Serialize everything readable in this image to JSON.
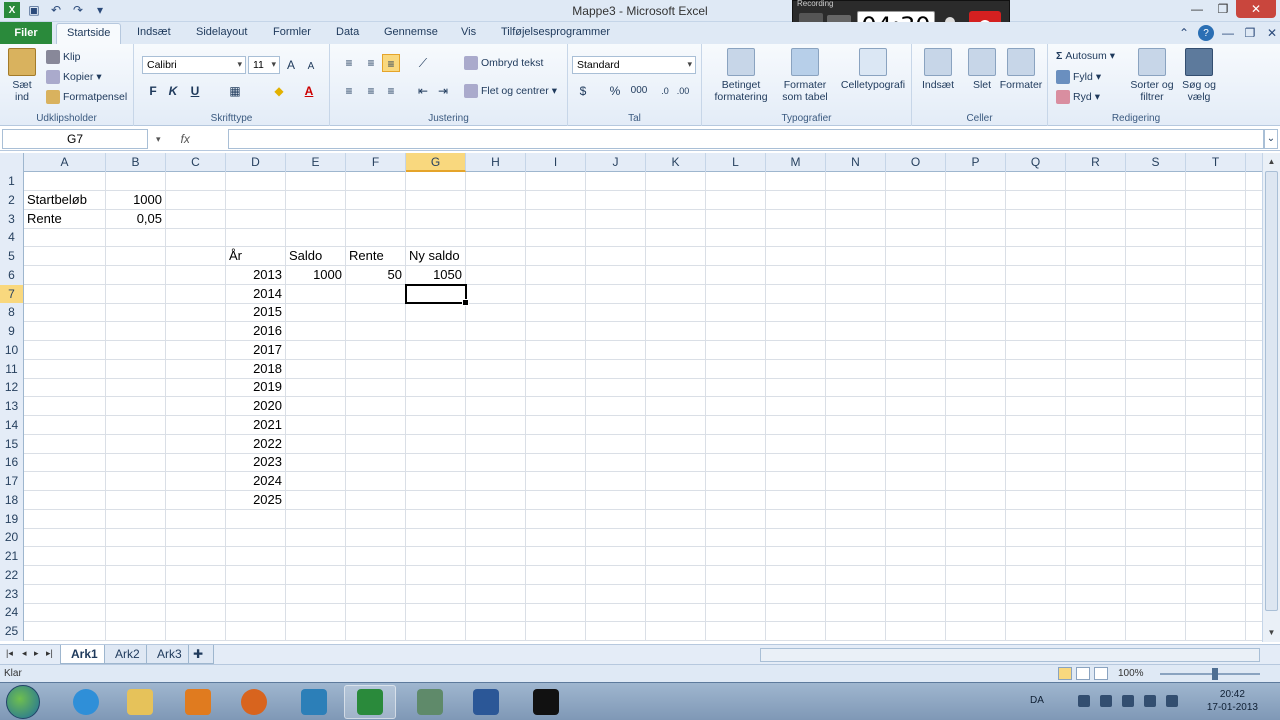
{
  "window": {
    "title": "Mappe3 - Microsoft Excel"
  },
  "recorder": {
    "label": "Recording",
    "time": "04:30"
  },
  "tabs": [
    {
      "label": "Filer"
    },
    {
      "label": "Startside"
    },
    {
      "label": "Indsæt"
    },
    {
      "label": "Sidelayout"
    },
    {
      "label": "Formler"
    },
    {
      "label": "Data"
    },
    {
      "label": "Gennemse"
    },
    {
      "label": "Vis"
    },
    {
      "label": "Tilføjelsesprogrammer"
    }
  ],
  "ribbon": {
    "clipboard": {
      "label": "Udklipsholder",
      "paste": "Sæt ind",
      "cut": "Klip",
      "copy": "Kopier",
      "format_painter": "Formatpensel"
    },
    "font": {
      "label": "Skrifttype",
      "name": "Calibri",
      "size": "11",
      "bold": "F",
      "italic": "K",
      "underline": "U"
    },
    "alignment": {
      "label": "Justering",
      "wrap": "Ombryd tekst",
      "merge": "Flet og centrer"
    },
    "number": {
      "label": "Tal",
      "format": "Standard",
      "percent": "%",
      "thousands": "000"
    },
    "styles": {
      "label": "Typografier",
      "conditional": "Betinget formatering",
      "as_table": "Formater som tabel",
      "cell_styles": "Celletypografi"
    },
    "cells": {
      "label": "Celler",
      "insert": "Indsæt",
      "delete": "Slet",
      "format": "Formater"
    },
    "editing": {
      "label": "Redigering",
      "autosum": "Autosum",
      "fill": "Fyld",
      "clear": "Ryd",
      "sort": "Sorter og filtrer",
      "find": "Søg og vælg"
    }
  },
  "formula_bar": {
    "name_box": "G7",
    "fx": "fx",
    "value": ""
  },
  "columns": [
    "A",
    "B",
    "C",
    "D",
    "E",
    "F",
    "G",
    "H",
    "I",
    "J",
    "K",
    "L",
    "M",
    "N",
    "O",
    "P",
    "Q",
    "R",
    "S",
    "T"
  ],
  "rows": [
    "1",
    "2",
    "3",
    "4",
    "5",
    "6",
    "7",
    "8",
    "9",
    "10",
    "11",
    "12",
    "13",
    "14",
    "15",
    "16",
    "17",
    "18",
    "19",
    "20",
    "21",
    "22",
    "23",
    "24",
    "25"
  ],
  "cells": {
    "A2": "Startbeløb",
    "B2": "1000",
    "A3": "Rente",
    "B3": "0,05",
    "D5": "År",
    "E5": "Saldo",
    "F5": "Rente",
    "G5": "Ny saldo",
    "D6": "2013",
    "E6": "1000",
    "F6": "50",
    "G6": "1050",
    "D7": "2014",
    "D8": "2015",
    "D9": "2016",
    "D10": "2017",
    "D11": "2018",
    "D12": "2019",
    "D13": "2020",
    "D14": "2021",
    "D15": "2022",
    "D16": "2023",
    "D17": "2024",
    "D18": "2025"
  },
  "active_cell": "G7",
  "sheets": [
    "Ark1",
    "Ark2",
    "Ark3"
  ],
  "active_sheet": "Ark1",
  "status": {
    "mode": "Klar",
    "zoom": "100%"
  },
  "tray": {
    "lang": "DA",
    "time": "20:42",
    "date": "17-01-2013"
  },
  "colors": {
    "accent": "#2a8a3b",
    "selected_header": "#f9d87e",
    "ribbon_bg": "#dfe9f5"
  }
}
